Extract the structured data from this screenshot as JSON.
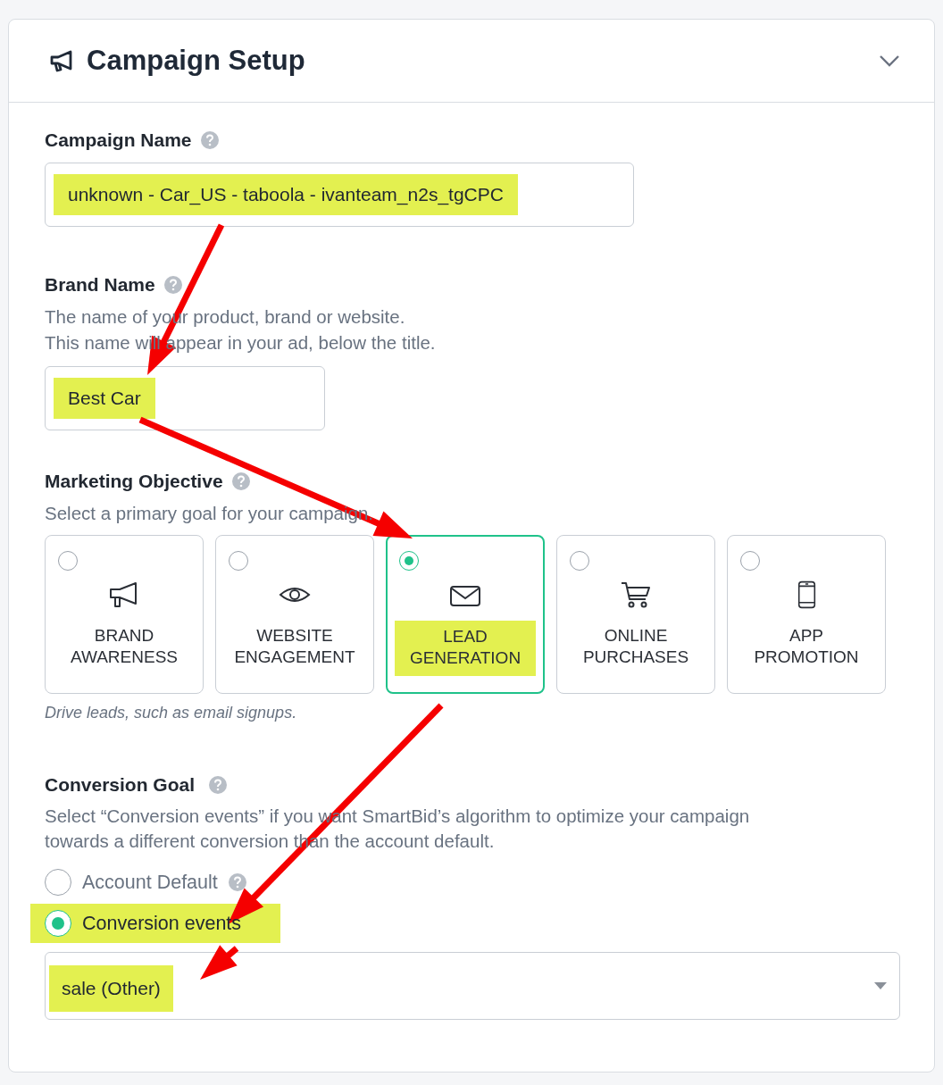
{
  "panel": {
    "title": "Campaign Setup",
    "expanded": true
  },
  "campaign_name": {
    "label": "Campaign Name",
    "value": "unknown - Car_US - taboola - ivanteam_n2s_tgCPC",
    "highlighted": true
  },
  "brand_name": {
    "label": "Brand Name",
    "description": [
      "The name of your product, brand or website.",
      "This name will appear in your ad, below the title."
    ],
    "value": "Best Car",
    "highlighted": true
  },
  "marketing_objective": {
    "label": "Marketing Objective",
    "description": "Select a primary goal for your campaign.",
    "options": [
      {
        "kind": "megaphone",
        "label": [
          "BRAND",
          "AWARENESS"
        ],
        "selected": false,
        "highlighted": false
      },
      {
        "kind": "eye",
        "label": [
          "WEBSITE",
          "ENGAGEMENT"
        ],
        "selected": false,
        "highlighted": false
      },
      {
        "kind": "envelope",
        "label": [
          "LEAD",
          "GENERATION"
        ],
        "selected": true,
        "highlighted": true
      },
      {
        "kind": "cart",
        "label": [
          "ONLINE",
          "PURCHASES"
        ],
        "selected": false,
        "highlighted": false
      },
      {
        "kind": "phone",
        "label": [
          "APP",
          "PROMOTION"
        ],
        "selected": false,
        "highlighted": false
      }
    ],
    "helper": "Drive leads, such as email signups."
  },
  "conversion_goal": {
    "label": "Conversion Goal",
    "description": [
      "Select “Conversion events” if you want SmartBid’s algorithm to optimize your campaign",
      "towards a different conversion than the account default."
    ],
    "options": [
      {
        "label": "Account Default",
        "selected": false,
        "help": true,
        "highlighted": false
      },
      {
        "label": "Conversion events",
        "selected": true,
        "help": false,
        "highlighted": true
      }
    ],
    "dropdown": {
      "value": "sale (Other)",
      "highlighted": true
    }
  }
}
